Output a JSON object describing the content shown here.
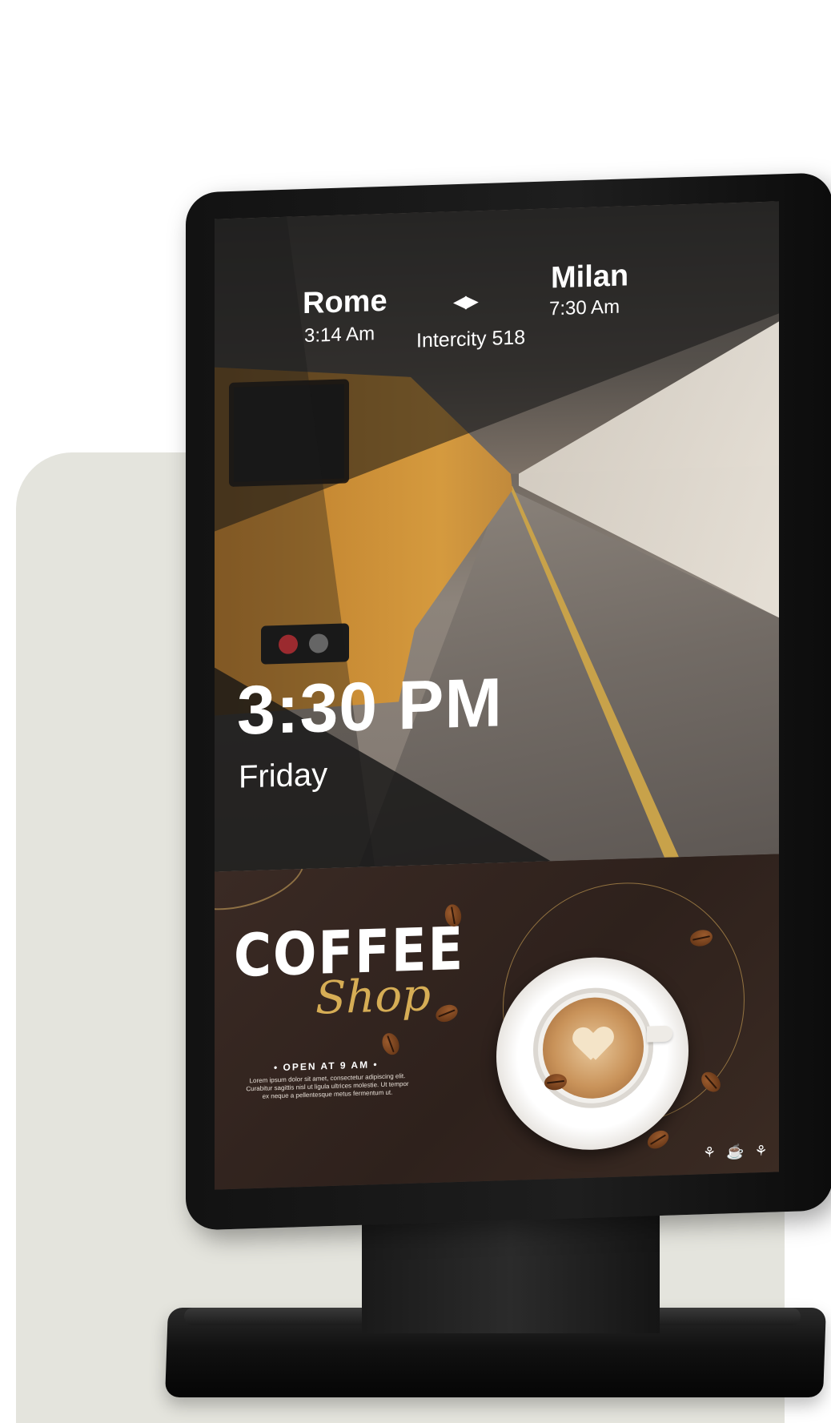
{
  "train_info": {
    "origin_city": "Rome",
    "origin_time": "3:14 Am",
    "destination_city": "Milan",
    "destination_time": "7:30 Am",
    "direction_symbol": "◀▶",
    "train_name": "Intercity 518"
  },
  "clock": {
    "time": "3:30 PM",
    "day": "Friday"
  },
  "coffee_ad": {
    "title_main": "COFFEE",
    "title_script": "Shop",
    "open_text": "• OPEN AT 9 AM •",
    "body_text": "Lorem ipsum dolor sit amet, consectetur adipiscing elit. Curabitur sagittis nisl ut ligula ultrices molestie. Ut tempor ex neque a pellentesque metus fermentum ut.",
    "footer_icons": "⚘ ☕ ⚘"
  },
  "colors": {
    "backdrop": "#e4e4dd",
    "accent_gold": "#d6ad55",
    "coffee_background": "#2e211c"
  }
}
